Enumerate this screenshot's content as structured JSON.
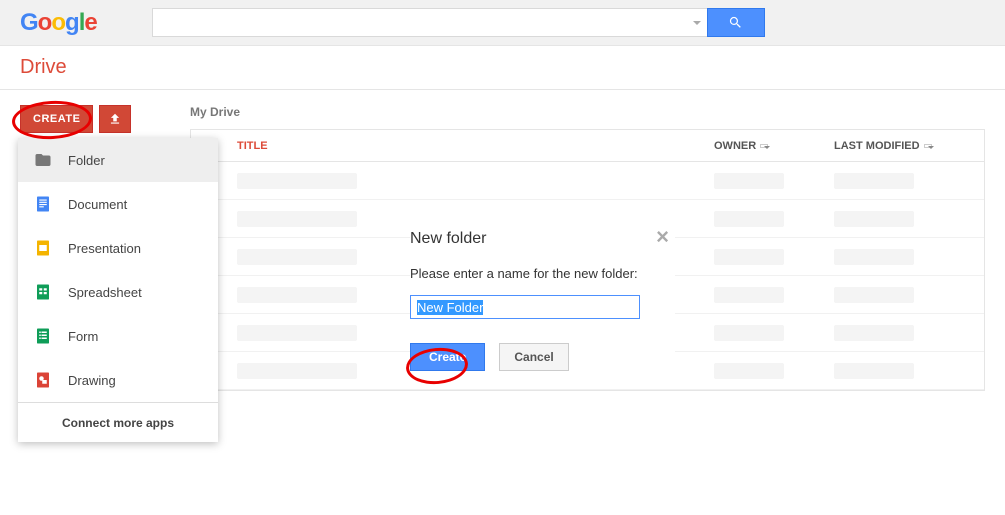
{
  "header": {
    "logo_text": "Google",
    "search_value": "",
    "search_placeholder": ""
  },
  "brand": {
    "name": "Drive"
  },
  "sidebar": {
    "create_label": "CREATE"
  },
  "location": {
    "breadcrumb": "My Drive"
  },
  "columns": {
    "title": "TITLE",
    "owner": "OWNER",
    "modified": "LAST MODIFIED"
  },
  "dropdown": {
    "items": [
      {
        "label": "Folder",
        "icon": "folder-icon",
        "color": "#777"
      },
      {
        "label": "Document",
        "icon": "document-icon",
        "color": "#4285f4"
      },
      {
        "label": "Presentation",
        "icon": "presentation-icon",
        "color": "#f4b400"
      },
      {
        "label": "Spreadsheet",
        "icon": "spreadsheet-icon",
        "color": "#0f9d58"
      },
      {
        "label": "Form",
        "icon": "form-icon",
        "color": "#0f9d58"
      },
      {
        "label": "Drawing",
        "icon": "drawing-icon",
        "color": "#db4437"
      }
    ],
    "footer": "Connect more apps"
  },
  "dialog": {
    "title": "New folder",
    "message": "Please enter a name for the new folder:",
    "input_value": "New Folder",
    "create_label": "Create",
    "cancel_label": "Cancel"
  },
  "file_row_count": 6
}
